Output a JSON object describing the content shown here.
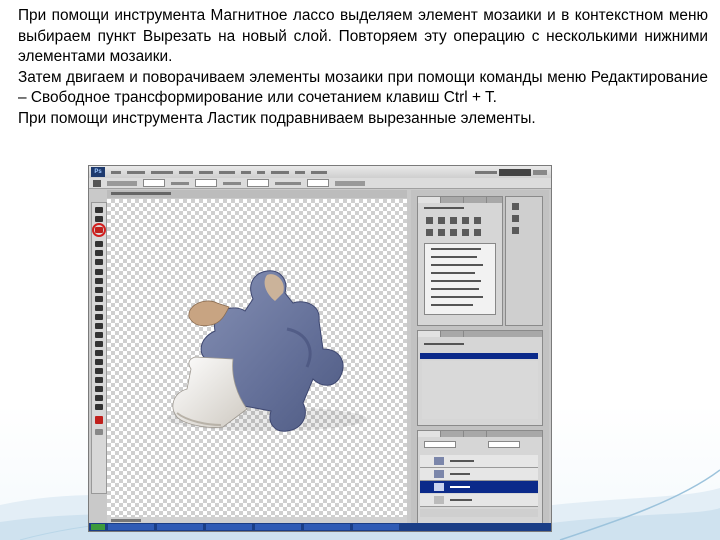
{
  "slide": {
    "paragraphs": [
      "При помощи инструмента Магнитное лассо выделяем элемент мозаики и в контекстном меню выбираем пункт Вырезать на новый слой. Повторяем эту операцию с несколькими нижними элементами мозаики.",
      "Затем двигаем и поворачиваем элементы мозаики при помощи команды меню Редактирование – Свободное трансформирование или сочетанием клавиш Ctrl + T.",
      "При помощи инструмента Ластик подравниваем вырезанные элементы."
    ]
  },
  "photoshop": {
    "logo": "Ps",
    "colors": {
      "highlight": "#d21f1f",
      "taskbar": "#1b3e86",
      "puzzle_blue": "#6f7fa6",
      "puzzle_white": "#f2f0ec",
      "puzzle_tan": "#c8a482"
    }
  }
}
